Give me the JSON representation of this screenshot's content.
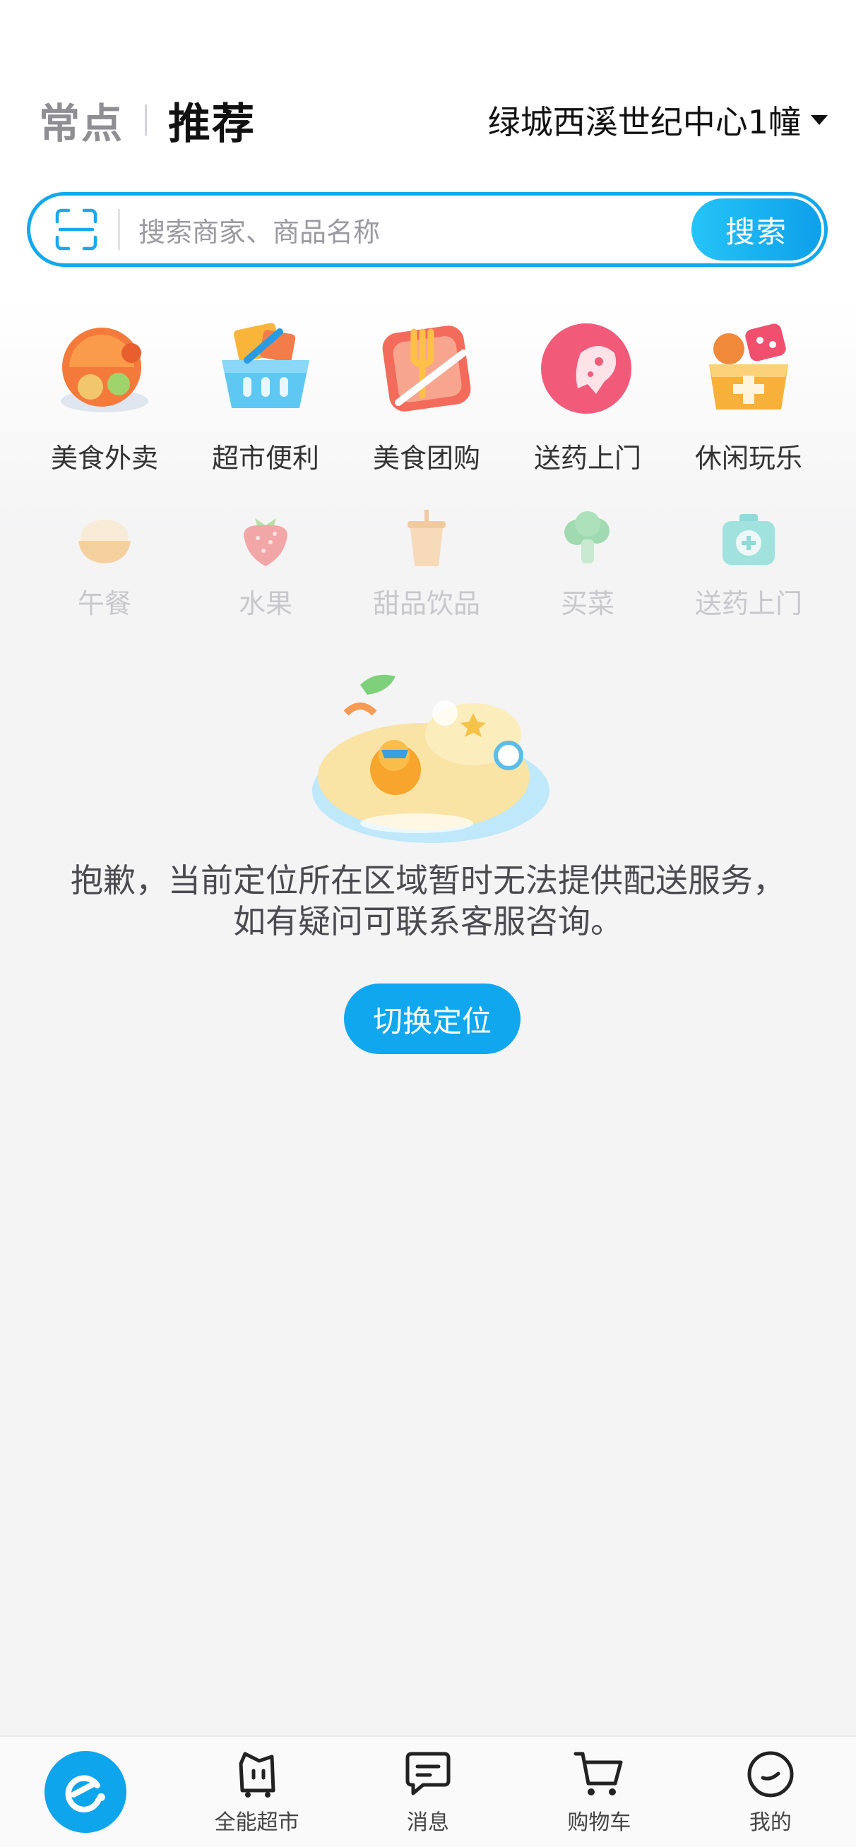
{
  "header": {
    "tab_frequent": "常点",
    "tab_recommend": "推荐",
    "location": "绿城西溪世纪中心1幢"
  },
  "search": {
    "placeholder": "搜索商家、商品名称",
    "button": "搜索"
  },
  "primary_categories": [
    {
      "label": "美食外卖",
      "icon": "food-delivery-icon"
    },
    {
      "label": "超市便利",
      "icon": "supermarket-basket-icon"
    },
    {
      "label": "美食团购",
      "icon": "group-buy-icon"
    },
    {
      "label": "送药上门",
      "icon": "medicine-delivery-icon"
    },
    {
      "label": "休闲玩乐",
      "icon": "leisure-icon"
    }
  ],
  "secondary_categories": [
    {
      "label": "午餐",
      "icon": "rice-bowl-icon"
    },
    {
      "label": "水果",
      "icon": "strawberry-icon"
    },
    {
      "label": "甜品饮品",
      "icon": "bubble-tea-icon"
    },
    {
      "label": "买菜",
      "icon": "broccoli-icon"
    },
    {
      "label": "送药上门",
      "icon": "first-aid-kit-icon"
    }
  ],
  "empty_state": {
    "message": "抱歉，当前定位所在区域暂时无法提供配送服务，如有疑问可联系客服咨询。",
    "button": "切换定位"
  },
  "bottom_nav": {
    "home_icon": "eleme-logo-icon",
    "items": [
      {
        "label": "全能超市",
        "icon": "shopping-bag-icon"
      },
      {
        "label": "消息",
        "icon": "message-icon"
      },
      {
        "label": "购物车",
        "icon": "cart-icon"
      },
      {
        "label": "我的",
        "icon": "profile-icon"
      }
    ]
  },
  "colors": {
    "accent": "#10a7ef",
    "primary_text": "#111111",
    "muted_text": "#8e8e93"
  }
}
